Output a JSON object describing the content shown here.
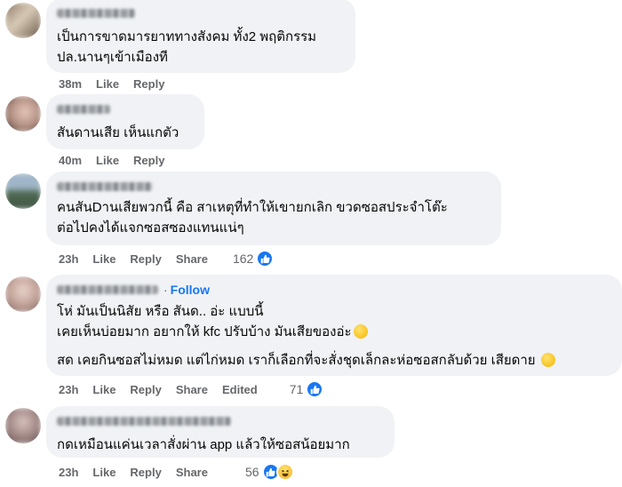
{
  "comments": [
    {
      "lines": [
        "เป็นการขาดมารยาททางสังคม ทั้ง2 พฤติกรรม",
        "ปล.นานๆเข้าเมืองที"
      ],
      "time": "38m",
      "like": "Like",
      "reply": "Reply"
    },
    {
      "lines": [
        "สันดานเสีย เห็นแกตัว"
      ],
      "time": "40m",
      "like": "Like",
      "reply": "Reply"
    },
    {
      "lines": [
        "คนสันDานเสียพวกนี้ คือ สาเหตุที่ทำให้เขายกเลิก ขวดซอสประจำโต๊ะ",
        "ต่อไปคงได้แจกซอสซองแทนแน่ๆ"
      ],
      "time": "23h",
      "like": "Like",
      "reply": "Reply",
      "share": "Share",
      "reactions": "162",
      "reaction_icons": [
        "like-icon"
      ]
    },
    {
      "follow": "Follow",
      "lines": [
        "โห่ มันเป็นนิสัย หรือ สันด.. อ่ะ แบบนี้",
        "เคยเห็นบ่อยมาก อยากให้ kfc ปรับบ้าง มันเสียของอ่ะ"
      ],
      "paragraph2": "สด เคยกินซอสไม่หมด แต่ไก่หมด เราก็เลือกที่จะสั่งชุดเล็กละห่อซอสกลับด้วย เสียดาย",
      "time": "23h",
      "like": "Like",
      "reply": "Reply",
      "share": "Share",
      "edited": "Edited",
      "reactions": "71",
      "reaction_icons": [
        "like-icon"
      ]
    },
    {
      "lines": [
        "กดเหมือนแค่นเวลาสั่งผ่าน app แล้วให้ซอสน้อยมาก"
      ],
      "time": "23h",
      "like": "Like",
      "reply": "Reply",
      "share": "Share",
      "reactions": "56",
      "reaction_icons": [
        "like-icon",
        "haha-icon"
      ]
    }
  ],
  "colors": {
    "bubble": "#f0f2f5",
    "accent": "#1877f2",
    "meta": "#65676b"
  }
}
